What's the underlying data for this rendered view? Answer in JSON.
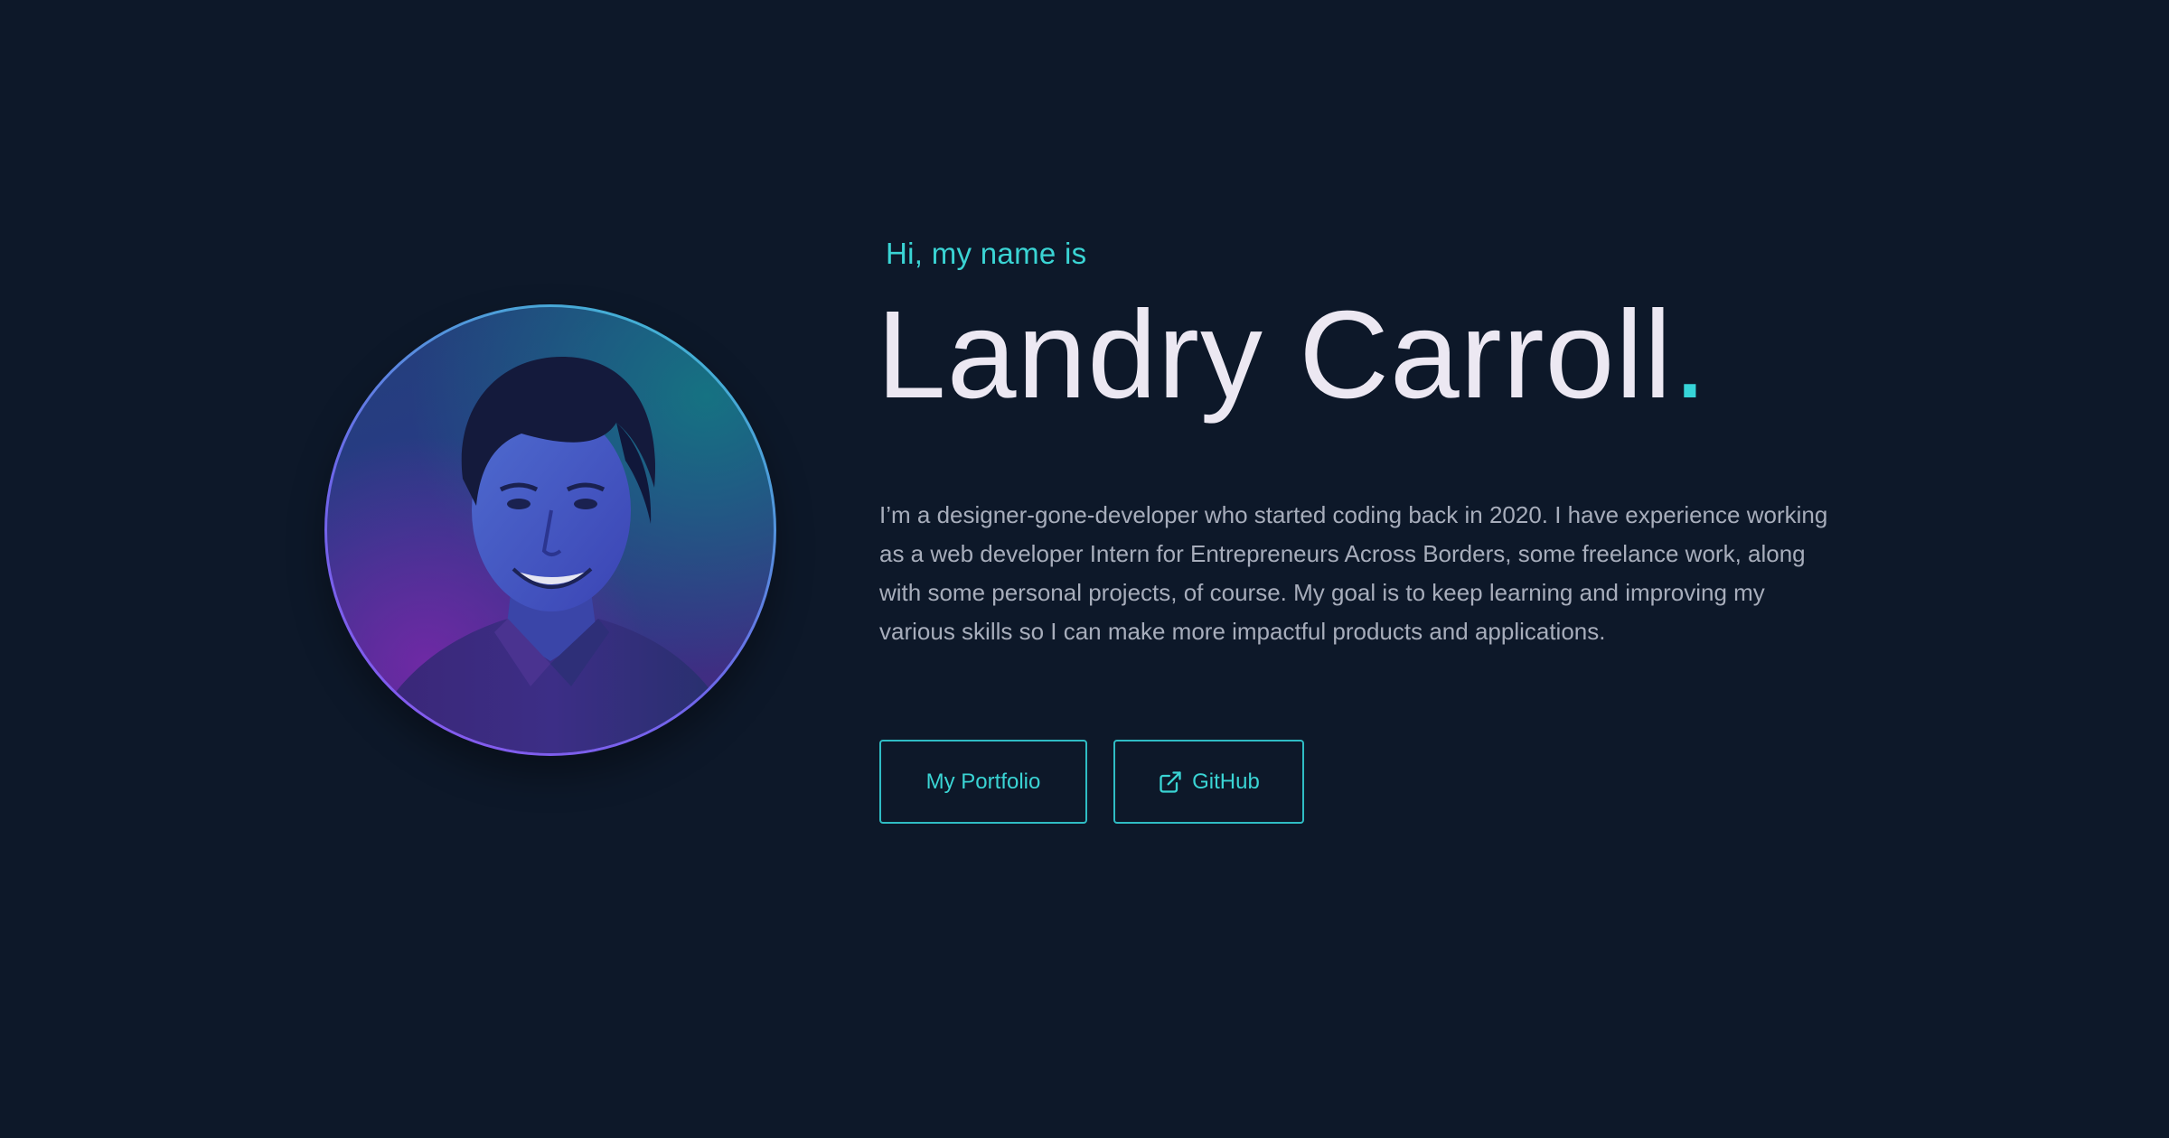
{
  "hero": {
    "greeting": "Hi, my name is",
    "name": "Landry Carroll",
    "name_suffix": ".",
    "bio": "I’m a designer-gone-developer who started coding back in 2020. I have experience working as a web developer Intern for Entrepreneurs Across Borders, some freelance work, along with some personal projects, of course. My goal is to keep learning and improving my various skills so I can make more impactful products and applications.",
    "avatar_icon": "profile-photo",
    "buttons": {
      "portfolio_label": "My Portfolio",
      "github_label": "GitHub",
      "github_icon": "external-link-icon"
    }
  },
  "colors": {
    "background": "#0d1829",
    "accent": "#3ad4d4",
    "name_text": "#ece8f2",
    "body_text": "#a7adbb"
  }
}
